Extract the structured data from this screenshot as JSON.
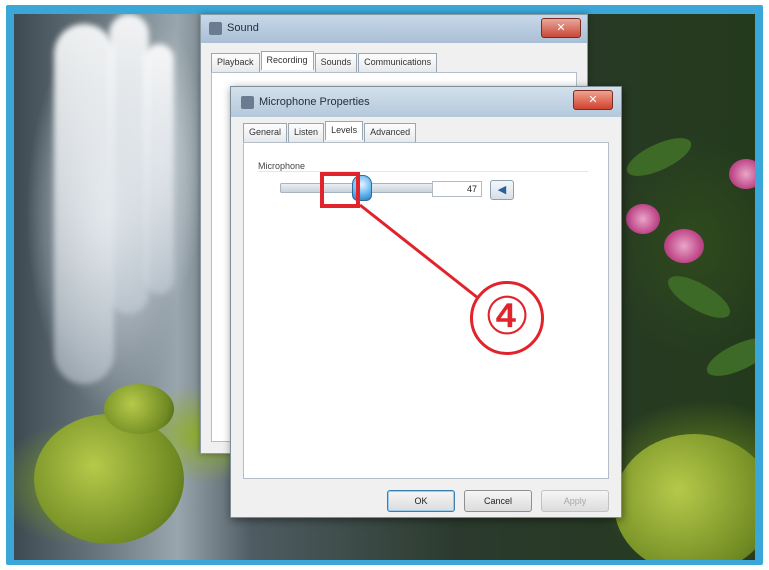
{
  "back_window": {
    "title": "Sound",
    "close_glyph": "✕",
    "tabs": [
      {
        "label": "Playback",
        "active": false
      },
      {
        "label": "Recording",
        "active": true
      },
      {
        "label": "Sounds",
        "active": false
      },
      {
        "label": "Communications",
        "active": false
      }
    ]
  },
  "front_window": {
    "title": "Microphone Properties",
    "close_glyph": "✕",
    "tabs": [
      {
        "label": "General",
        "active": false
      },
      {
        "label": "Listen",
        "active": false
      },
      {
        "label": "Levels",
        "active": true
      },
      {
        "label": "Advanced",
        "active": false
      }
    ],
    "levels": {
      "group_label": "Microphone",
      "value": "47",
      "slider_percent": 47,
      "mute_icon": "speaker-icon",
      "mute_glyph": "◀"
    },
    "buttons": {
      "ok": "OK",
      "cancel": "Cancel",
      "apply": "Apply"
    }
  },
  "annotation": {
    "step_number": "④",
    "color": "#e1242b"
  },
  "colors": {
    "frame": "#3aa7d8",
    "slider_thumb": "#67b8ef"
  }
}
